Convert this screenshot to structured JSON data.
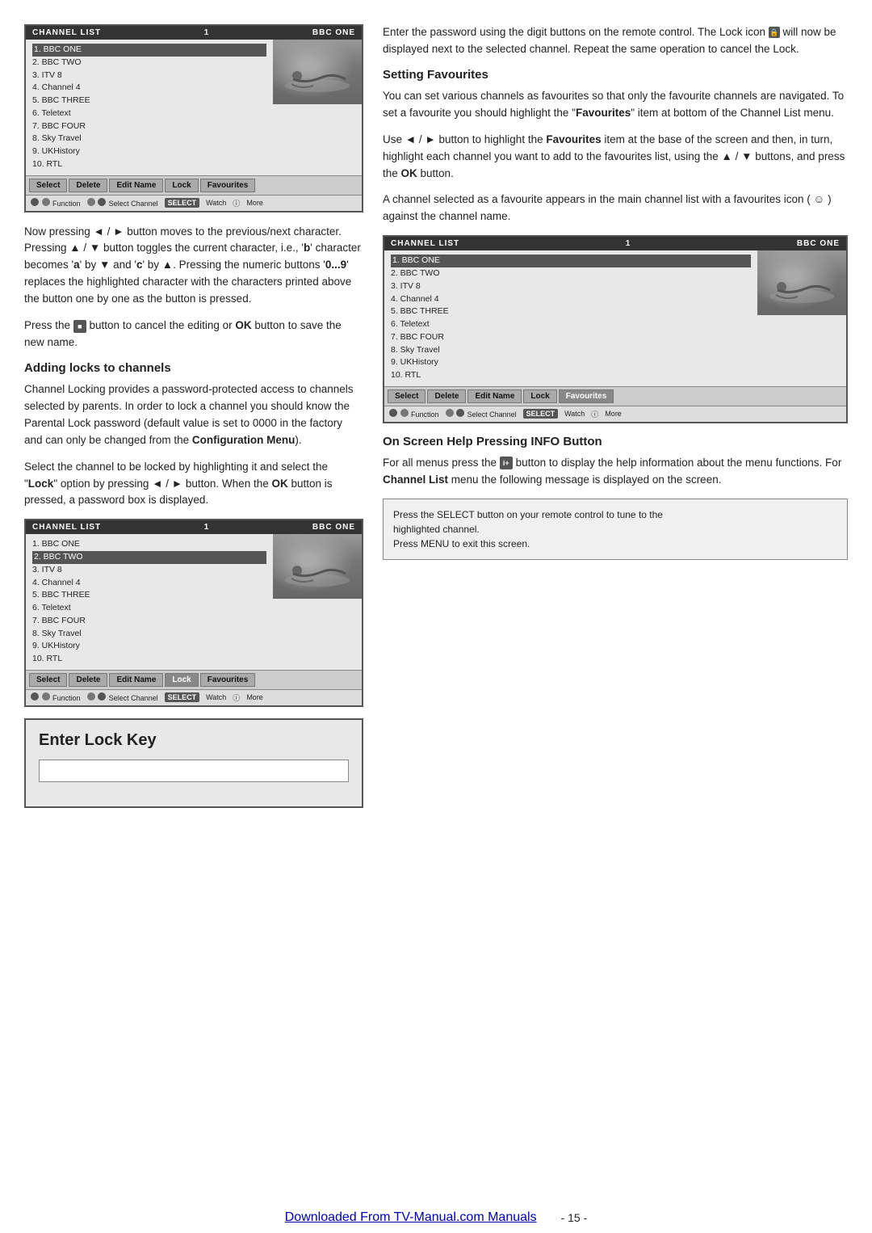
{
  "page": {
    "title": "Channel List Manual Page",
    "page_number": "- 15 -",
    "footer_link": "Downloaded From TV-Manual.com Manuals"
  },
  "left_col": {
    "box1": {
      "header": {
        "left": "CHANNEL LIST",
        "center": "1",
        "right": "BBC ONE"
      },
      "channels": [
        "1. BBC ONE",
        "2. BBC TWO",
        "3. ITV 8",
        "4. Channel 4",
        "5. BBC THREE",
        "6. Teletext",
        "7. BBC FOUR",
        "8. Sky Travel",
        "9. UKHistory",
        "10. RTL"
      ],
      "toolbar": [
        "Select",
        "Delete",
        "Edit Name",
        "Lock",
        "Favourites"
      ],
      "footer": "Function  Select Channel  Watch  More"
    },
    "para1": "Now  pressing ◄ / ► button moves to the previous/next character. Pressing ▲ / ▼ button toggles the current character, i.e., 'b' character becomes 'a' by ▼ and 'c' by ▲. Pressing the numeric buttons '0...9' replaces the highlighted character with the characters printed above the button one by one as the button is pressed.",
    "para2": "Press the  button to cancel the editing or OK button to save the new name.",
    "section1": {
      "title": "Adding locks to channels",
      "text": "Channel Locking provides a password-protected access to channels selected by parents. In order to lock a channel you should know the Parental Lock password (default value is set to 0000 in the factory and can only be changed from the Configuration Menu).",
      "text2": "Select the channel to be locked by highlighting it and select the \"Lock\" option by pressing ◄ / ► button. When the OK button is pressed, a password box is displayed."
    },
    "box2": {
      "header": {
        "left": "CHANNEL LIST",
        "center": "1",
        "right": "BBC ONE"
      },
      "channels": [
        "1. BBC ONE",
        "2. BBC TWO",
        "3. ITV 8",
        "4. Channel 4",
        "5. BBC THREE",
        "6. Teletext",
        "7. BBC FOUR",
        "8. Sky Travel",
        "9. UKHistory",
        "10. RTL"
      ],
      "toolbar": [
        "Select",
        "Delete",
        "Edit Name",
        "Lock",
        "Favourites"
      ],
      "footer": "Function  Select Channel  Watch  More"
    },
    "lock_box": {
      "title": "Enter Lock Key",
      "input_placeholder": ""
    }
  },
  "right_col": {
    "para_top": "Enter the password using the digit buttons on the remote control. The Lock icon  will now be displayed next to the selected channel. Repeat the same operation to cancel the Lock.",
    "section_favourites": {
      "title": "Setting Favourites",
      "text1": "You can set various channels as favourites so that only the favourite channels are navigated. To set a favourite you should highlight the \"Favourites\" item at bottom of the Channel List menu.",
      "text2": "Use ◄ / ► button to highlight the Favourites item at the base of the screen and then, in turn, highlight each channel you want to add to the favourites list, using the ▲ / ▼ buttons, and press the OK button.",
      "text3": "A channel selected as a favourite appears in the main channel list with a favourites icon (☺) against the channel name."
    },
    "box3": {
      "header": {
        "left": "CHANNEL LIST",
        "center": "1",
        "right": "BBC ONE"
      },
      "channels": [
        "1. BBC ONE",
        "2. BBC TWO",
        "3. ITV 8",
        "4. Channel 4",
        "5. BBC THREE",
        "6. Teletext",
        "7. BBC FOUR",
        "8. Sky Travel",
        "9. UKHistory",
        "10. RTL"
      ],
      "toolbar": [
        "Select",
        "Delete",
        "Edit Name",
        "Lock",
        "Favourites"
      ],
      "footer": "Function  Select Channel  Watch  More"
    },
    "section_help": {
      "title": "On Screen Help Pressing INFO Button",
      "text": "For all menus press the  button to display the help information about the menu functions. For Channel List menu the following message is displayed on the screen."
    },
    "info_box": {
      "line1": "Press the SELECT button on your remote control to tune to the",
      "line2": "highlighted channel.",
      "line3": "Press MENU to exit this screen."
    }
  }
}
